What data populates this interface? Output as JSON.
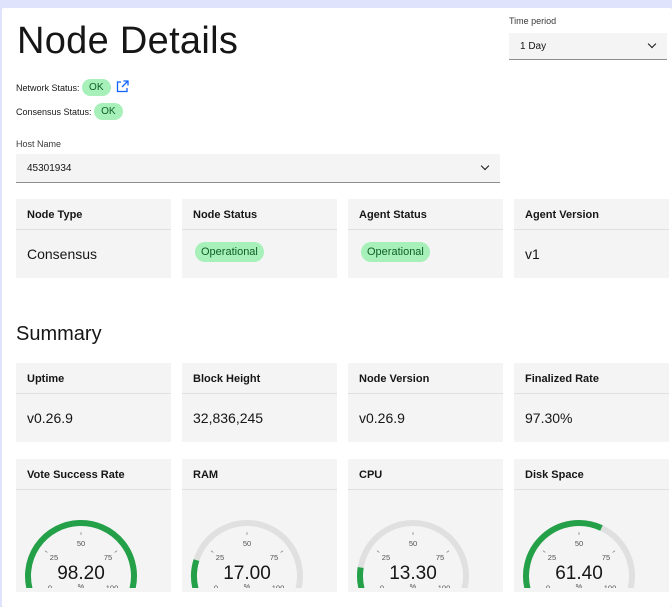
{
  "page_title": "Node Details",
  "time_period": {
    "label": "Time period",
    "value": "1 Day"
  },
  "network_status": {
    "label": "Network Status:",
    "value": "OK"
  },
  "consensus_status": {
    "label": "Consensus Status:",
    "value": "OK"
  },
  "host": {
    "label": "Host Name",
    "value": "45301934"
  },
  "node_cards": [
    {
      "title": "Node Type",
      "value": "Consensus"
    },
    {
      "title": "Node Status",
      "value": "Operational"
    },
    {
      "title": "Agent Status",
      "value": "Operational"
    },
    {
      "title": "Agent Version",
      "value": "v1"
    }
  ],
  "summary_title": "Summary",
  "summary_cards": [
    {
      "title": "Uptime",
      "value": "v0.26.9"
    },
    {
      "title": "Block Height",
      "value": "32,836,245"
    },
    {
      "title": "Node Version",
      "value": "v0.26.9"
    },
    {
      "title": "Finalized Rate",
      "value": "97.30%"
    }
  ],
  "gauge_ticks": [
    "0",
    "25",
    "50",
    "75",
    "100"
  ],
  "gauges": [
    {
      "title": "Vote Success Rate",
      "value": 98.2,
      "display": "98.20",
      "unit": "%"
    },
    {
      "title": "RAM",
      "value": 17.0,
      "display": "17.00",
      "unit": "%"
    },
    {
      "title": "CPU",
      "value": 13.3,
      "display": "13.30",
      "unit": "%"
    },
    {
      "title": "Disk Space",
      "value": 61.4,
      "display": "61.40",
      "unit": "%"
    }
  ],
  "colors": {
    "ok_tag_bg": "#a7f0ba",
    "ok_tag_text": "#0e6027",
    "gauge_fill": "#24a148",
    "gauge_track": "#e0e0e0",
    "link": "#0f62fe"
  }
}
